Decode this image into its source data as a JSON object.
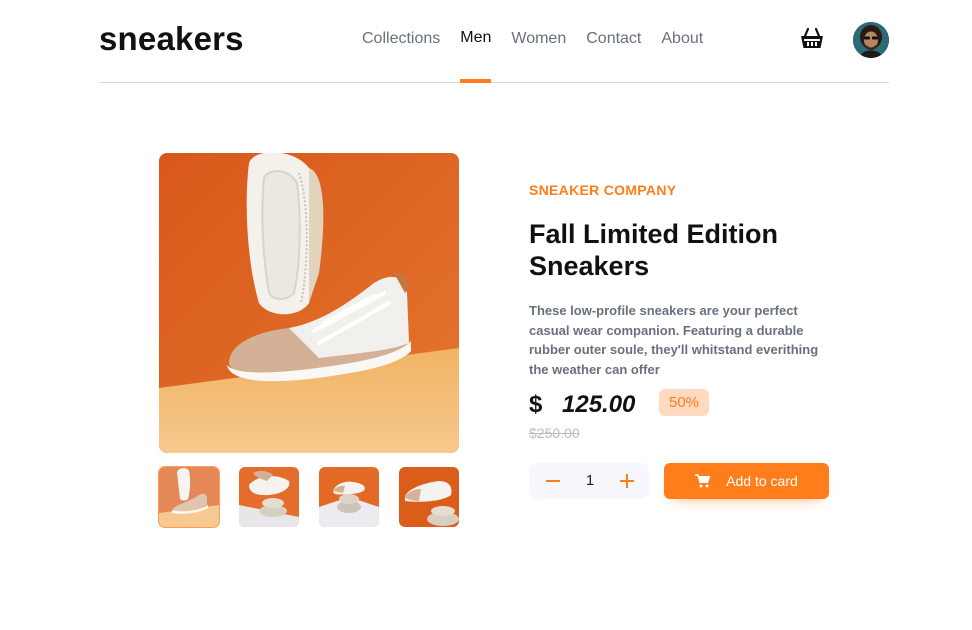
{
  "header": {
    "logo": "sneakers",
    "nav": [
      {
        "label": "Collections",
        "active": false
      },
      {
        "label": "Men",
        "active": true
      },
      {
        "label": "Women",
        "active": false
      },
      {
        "label": "Contact",
        "active": false
      },
      {
        "label": "About",
        "active": false
      }
    ],
    "cart_icon": "cart-icon",
    "avatar_icon": "avatar"
  },
  "gallery": {
    "main_image": "sneaker-hero-image",
    "thumbnails": [
      "thumbnail-1",
      "thumbnail-2",
      "thumbnail-3",
      "thumbnail-4"
    ],
    "selected_thumbnail": 1
  },
  "product": {
    "company": "SNEAKER COMPANY",
    "title": "Fall Limited Edition Sneakers",
    "description": "These low-profile sneakers are your perfect casual wear companion. Featuring a durable rubber outer soule, they'll whitstand everithing the weather can offer",
    "currency": "$",
    "price": "125.00",
    "discount": "50%",
    "old_price": "$250.00",
    "quantity": "1",
    "add_button": "Add to card"
  },
  "colors": {
    "accent": "#ff7d1a",
    "accent_pale": "#ffd9c0",
    "text_dark": "#111111",
    "text_grey": "#69707d"
  }
}
